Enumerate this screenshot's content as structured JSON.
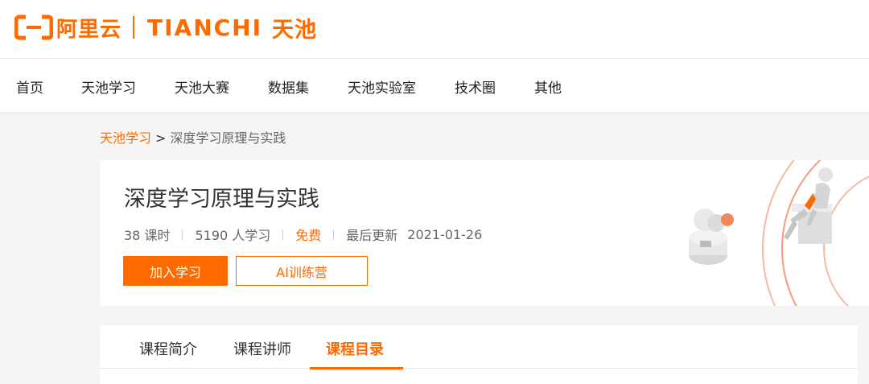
{
  "header": {
    "logo_aliyun": "阿里云",
    "logo_tianchi": "TIANCHI",
    "logo_tianchi_cn": "天池"
  },
  "nav": {
    "items": [
      "首页",
      "天池学习",
      "天池大赛",
      "数据集",
      "天池实验室",
      "技术圈",
      "其他"
    ]
  },
  "breadcrumb": {
    "parent": "天池学习",
    "separator": ">",
    "current": "深度学习原理与实践"
  },
  "course": {
    "title": "深度学习原理与实践",
    "lessons": "38 课时",
    "learners": "5190 人学习",
    "price": "免费",
    "updated_label": "最后更新",
    "updated_date": "2021-01-26",
    "join_button": "加入学习",
    "ai_camp_button": "AI训练营"
  },
  "tabs": {
    "items": [
      "课程简介",
      "课程讲师",
      "课程目录"
    ],
    "active_index": 2
  },
  "colors": {
    "accent": "#ff6a00",
    "background": "#f5f5f5",
    "text": "#333333"
  },
  "icons": [
    "aliyun-logo-icon",
    "hero-robot-illustration"
  ]
}
